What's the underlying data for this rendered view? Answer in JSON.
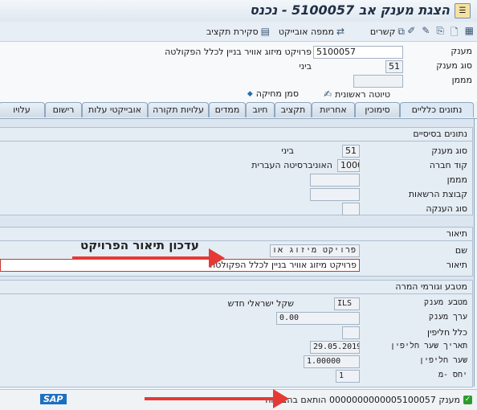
{
  "window": {
    "title": "הצגת מענק אב 5100057 - נכנס"
  },
  "toolbar": {
    "items": [
      {
        "label": "קשרים",
        "icon": "connections-icon"
      },
      {
        "label": "ממפה אובייקט",
        "icon": "object-mapper-icon"
      },
      {
        "label": "סקירת תקציב",
        "icon": "budget-overview-icon"
      }
    ]
  },
  "header": {
    "grant_label": "מענק",
    "grant_value": "5100057",
    "grant_description": "פרויקט מיזוג אוויר בניין לכלל הפקולטה",
    "grant_type_label": "סוג מענק",
    "grant_type_value": "51",
    "grant_type_desc": "ביני",
    "sponsor_label": "מממן",
    "sponsor_value": "",
    "draft_label": "טיוטה ראשונית",
    "delete_flag_label": "סמן מחיקה"
  },
  "tabs": [
    {
      "label": "נתונים כלליים",
      "active": true
    },
    {
      "label": "סימוכין"
    },
    {
      "label": "אחריות"
    },
    {
      "label": "תקציב"
    },
    {
      "label": "חיוב"
    },
    {
      "label": "ממדים"
    },
    {
      "label": "עלויות תקורה"
    },
    {
      "label": "אובייקטי עלות"
    },
    {
      "label": "רישום"
    },
    {
      "label": "עלויו"
    }
  ],
  "basic": {
    "heading": "נתונים בסיסיים",
    "grant_type_label": "סוג מענק",
    "grant_type_value": "51",
    "grant_type_desc": "ביני",
    "company_code_label": "קוד חברה",
    "company_code_value": "1000",
    "company_code_desc": "האוניברסיטה העברית",
    "sponsor_label": "מממן",
    "registration_group_label": "קבוצת הרשאות",
    "grant_subtype_label": "סוג הענקה"
  },
  "description": {
    "heading": "תיאור",
    "name_label": "שם",
    "name_value": "פרויקט מיזוג אוויר",
    "desc_label": "תיאור",
    "desc_value": "פרויקט מיזוג אוויר בניין לכלל הפקולטה"
  },
  "currency": {
    "heading": "מטבע וגורמי המרה",
    "currency_label": "מטבע מענק",
    "currency_value": "ILS",
    "currency_desc": "שקל ישראלי חדש",
    "value_label": "ערך מענק",
    "value_value": "0.00",
    "exchange_rule_label": "כלל חליפין",
    "rate_date_label": "תאריך שער חליפין",
    "rate_date_value": "29.05.2019",
    "rate_label": "שער חליפין",
    "rate_value": "1.00000",
    "ratio_label": "יחס -מ",
    "ratio_value": "1"
  },
  "status": {
    "message": "מענק 0000000000005100057 הותאם בהצלחה",
    "logo": "SAP"
  },
  "annotations": {
    "update_description": "עדכון תיאור הפרויקט"
  },
  "colors": {
    "arrow": "#e53935",
    "panel": "#dce6f0",
    "success": "#2e9b2e"
  }
}
